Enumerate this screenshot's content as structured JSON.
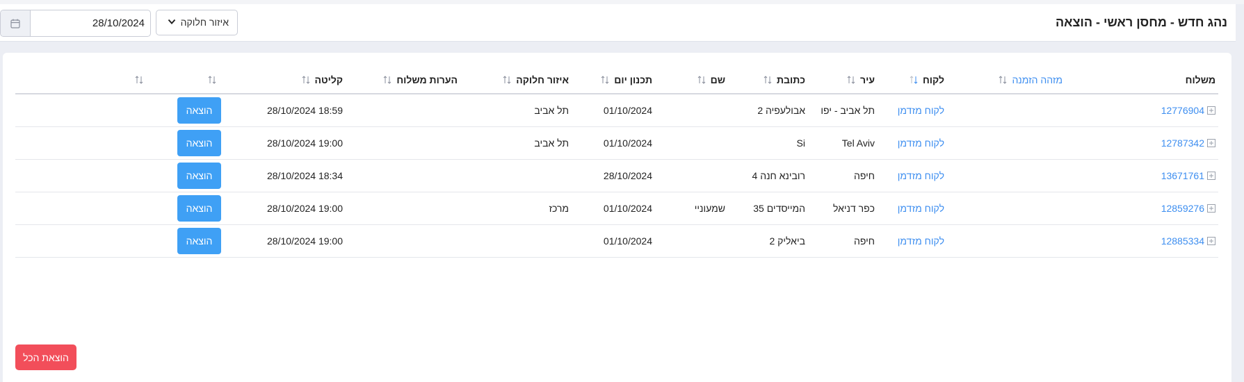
{
  "header": {
    "title": "נהג חדש - מחסן ראשי - הוצאה",
    "date_value": "28/10/2024",
    "region_label": "איזור חלוקה"
  },
  "table": {
    "columns": [
      "משלוח",
      "מזהה הזמנה",
      "לקוח",
      "עיר",
      "כתובת",
      "שם",
      "תכנון יום",
      "איזור חלוקה",
      "הערות משלוח",
      "קליטה",
      "",
      ""
    ],
    "rows": [
      {
        "shipment": "12776904",
        "order_id": "",
        "customer": "לקוח מזדמן",
        "city": "תל אביב - יפו",
        "address": "אבולעפיה 2",
        "name": "",
        "plan_day": "01/10/2024",
        "region": "תל אביב",
        "notes": "",
        "received": "18:59 28/10/2024",
        "action": "הוצאה"
      },
      {
        "shipment": "12787342",
        "order_id": "",
        "customer": "לקוח מזדמן",
        "city": "Tel Aviv",
        "address": "Si",
        "name": "",
        "plan_day": "01/10/2024",
        "region": "תל אביב",
        "notes": "",
        "received": "19:00 28/10/2024",
        "action": "הוצאה"
      },
      {
        "shipment": "13671761",
        "order_id": "",
        "customer": "לקוח מזדמן",
        "city": "חיפה",
        "address": "רובינא חנה 4",
        "name": "",
        "plan_day": "28/10/2024",
        "region": "",
        "notes": "",
        "received": "18:34 28/10/2024",
        "action": "הוצאה"
      },
      {
        "shipment": "12859276",
        "order_id": "",
        "customer": "לקוח מזדמן",
        "city": "כפר דניאל",
        "address": "המייסדים 35",
        "name": "שמעוניי",
        "plan_day": "01/10/2024",
        "region": "מרכז",
        "notes": "",
        "received": "19:00 28/10/2024",
        "action": "הוצאה"
      },
      {
        "shipment": "12885334",
        "order_id": "",
        "customer": "לקוח מזדמן",
        "city": "חיפה",
        "address": "ביאליק 2",
        "name": "",
        "plan_day": "01/10/2024",
        "region": "",
        "notes": "",
        "received": "19:00 28/10/2024",
        "action": "הוצאה"
      }
    ]
  },
  "footer": {
    "release_all_label": "הוצאת הכל"
  },
  "colors": {
    "accent": "#3d8ef0",
    "button": "#3fa0f5",
    "danger": "#f24e5a"
  }
}
